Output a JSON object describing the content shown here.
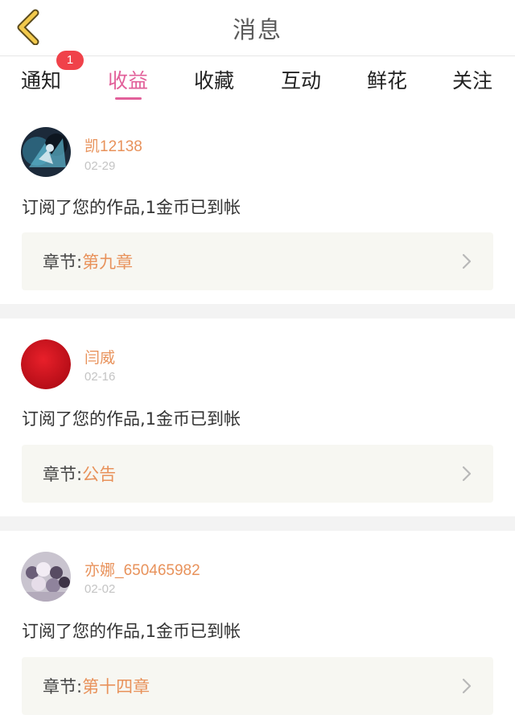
{
  "header": {
    "title": "消息",
    "back_icon": "chevron-left-icon"
  },
  "tabs": [
    {
      "label": "通知",
      "badge": "1"
    },
    {
      "label": "收益",
      "active": true
    },
    {
      "label": "收藏"
    },
    {
      "label": "互动"
    },
    {
      "label": "鲜花"
    },
    {
      "label": "关注"
    }
  ],
  "colors": {
    "accent": "#e2609a",
    "username": "#e8925b",
    "badge": "#f0424a"
  },
  "items": [
    {
      "username": "凯12138",
      "date": "02-29",
      "message": "订阅了您的作品,1金币已到帐",
      "chapter_label": "章节:",
      "chapter_name": "第九章",
      "avatar": "anime-character-avatar"
    },
    {
      "username": "闫威",
      "date": "02-16",
      "message": "订阅了您的作品,1金币已到帐",
      "chapter_label": "章节:",
      "chapter_name": "公告",
      "avatar": "red-circle-avatar"
    },
    {
      "username": "亦娜_650465982",
      "date": "02-02",
      "message": "订阅了您的作品,1金币已到帐",
      "chapter_label": "章节:",
      "chapter_name": "第十四章",
      "avatar": "group-photo-avatar"
    }
  ]
}
